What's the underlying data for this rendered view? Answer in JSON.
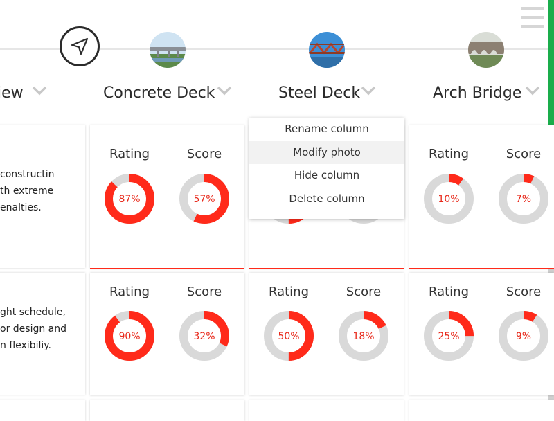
{
  "columns": [
    {
      "title": "iew"
    },
    {
      "title": "Concrete Deck"
    },
    {
      "title": "Steel Deck"
    },
    {
      "title": "Arch Bridge"
    }
  ],
  "context_menu": {
    "items": [
      "Rename column",
      "Modify photo",
      "Hide column",
      "Delete column"
    ],
    "hovered": "Modify photo"
  },
  "rows": [
    {
      "description": [
        "constructin",
        "th extreme",
        "enalties."
      ],
      "metrics": [
        {
          "rating": 87,
          "score": 57
        },
        {
          "rating": null,
          "score": null
        },
        {
          "rating": 10,
          "score": 7
        }
      ]
    },
    {
      "description": [
        "ght schedule,",
        "or design and",
        "n flexibiliy."
      ],
      "metrics": [
        {
          "rating": 90,
          "score": 32
        },
        {
          "rating": 50,
          "score": 18
        },
        {
          "rating": 25,
          "score": 9
        }
      ]
    }
  ],
  "labels": {
    "rating": "Rating",
    "score": "Score"
  },
  "colors": {
    "accent": "#ff2a1a",
    "track": "#d9d9d9",
    "scrollbar": "#1aad4b"
  }
}
